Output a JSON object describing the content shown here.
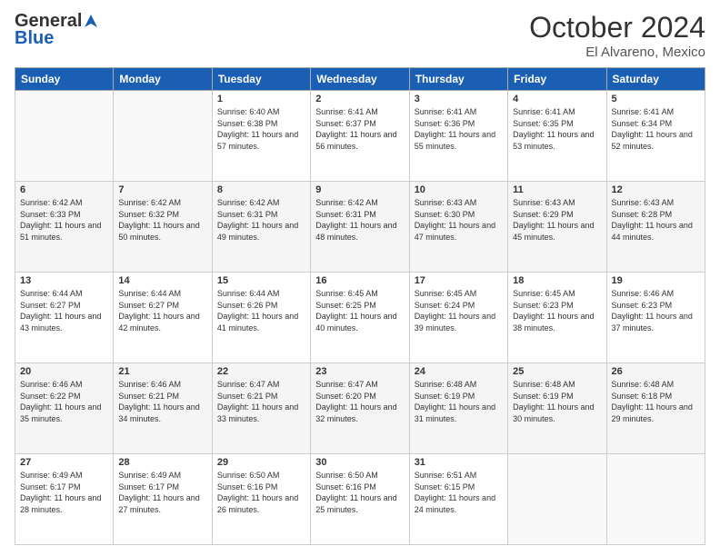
{
  "header": {
    "logo_general": "General",
    "logo_blue": "Blue",
    "month_title": "October 2024",
    "location": "El Alvareno, Mexico"
  },
  "weekdays": [
    "Sunday",
    "Monday",
    "Tuesday",
    "Wednesday",
    "Thursday",
    "Friday",
    "Saturday"
  ],
  "weeks": [
    [
      {
        "day": "",
        "sunrise": "",
        "sunset": "",
        "daylight": ""
      },
      {
        "day": "",
        "sunrise": "",
        "sunset": "",
        "daylight": ""
      },
      {
        "day": "1",
        "sunrise": "Sunrise: 6:40 AM",
        "sunset": "Sunset: 6:38 PM",
        "daylight": "Daylight: 11 hours and 57 minutes."
      },
      {
        "day": "2",
        "sunrise": "Sunrise: 6:41 AM",
        "sunset": "Sunset: 6:37 PM",
        "daylight": "Daylight: 11 hours and 56 minutes."
      },
      {
        "day": "3",
        "sunrise": "Sunrise: 6:41 AM",
        "sunset": "Sunset: 6:36 PM",
        "daylight": "Daylight: 11 hours and 55 minutes."
      },
      {
        "day": "4",
        "sunrise": "Sunrise: 6:41 AM",
        "sunset": "Sunset: 6:35 PM",
        "daylight": "Daylight: 11 hours and 53 minutes."
      },
      {
        "day": "5",
        "sunrise": "Sunrise: 6:41 AM",
        "sunset": "Sunset: 6:34 PM",
        "daylight": "Daylight: 11 hours and 52 minutes."
      }
    ],
    [
      {
        "day": "6",
        "sunrise": "Sunrise: 6:42 AM",
        "sunset": "Sunset: 6:33 PM",
        "daylight": "Daylight: 11 hours and 51 minutes."
      },
      {
        "day": "7",
        "sunrise": "Sunrise: 6:42 AM",
        "sunset": "Sunset: 6:32 PM",
        "daylight": "Daylight: 11 hours and 50 minutes."
      },
      {
        "day": "8",
        "sunrise": "Sunrise: 6:42 AM",
        "sunset": "Sunset: 6:31 PM",
        "daylight": "Daylight: 11 hours and 49 minutes."
      },
      {
        "day": "9",
        "sunrise": "Sunrise: 6:42 AM",
        "sunset": "Sunset: 6:31 PM",
        "daylight": "Daylight: 11 hours and 48 minutes."
      },
      {
        "day": "10",
        "sunrise": "Sunrise: 6:43 AM",
        "sunset": "Sunset: 6:30 PM",
        "daylight": "Daylight: 11 hours and 47 minutes."
      },
      {
        "day": "11",
        "sunrise": "Sunrise: 6:43 AM",
        "sunset": "Sunset: 6:29 PM",
        "daylight": "Daylight: 11 hours and 45 minutes."
      },
      {
        "day": "12",
        "sunrise": "Sunrise: 6:43 AM",
        "sunset": "Sunset: 6:28 PM",
        "daylight": "Daylight: 11 hours and 44 minutes."
      }
    ],
    [
      {
        "day": "13",
        "sunrise": "Sunrise: 6:44 AM",
        "sunset": "Sunset: 6:27 PM",
        "daylight": "Daylight: 11 hours and 43 minutes."
      },
      {
        "day": "14",
        "sunrise": "Sunrise: 6:44 AM",
        "sunset": "Sunset: 6:27 PM",
        "daylight": "Daylight: 11 hours and 42 minutes."
      },
      {
        "day": "15",
        "sunrise": "Sunrise: 6:44 AM",
        "sunset": "Sunset: 6:26 PM",
        "daylight": "Daylight: 11 hours and 41 minutes."
      },
      {
        "day": "16",
        "sunrise": "Sunrise: 6:45 AM",
        "sunset": "Sunset: 6:25 PM",
        "daylight": "Daylight: 11 hours and 40 minutes."
      },
      {
        "day": "17",
        "sunrise": "Sunrise: 6:45 AM",
        "sunset": "Sunset: 6:24 PM",
        "daylight": "Daylight: 11 hours and 39 minutes."
      },
      {
        "day": "18",
        "sunrise": "Sunrise: 6:45 AM",
        "sunset": "Sunset: 6:23 PM",
        "daylight": "Daylight: 11 hours and 38 minutes."
      },
      {
        "day": "19",
        "sunrise": "Sunrise: 6:46 AM",
        "sunset": "Sunset: 6:23 PM",
        "daylight": "Daylight: 11 hours and 37 minutes."
      }
    ],
    [
      {
        "day": "20",
        "sunrise": "Sunrise: 6:46 AM",
        "sunset": "Sunset: 6:22 PM",
        "daylight": "Daylight: 11 hours and 35 minutes."
      },
      {
        "day": "21",
        "sunrise": "Sunrise: 6:46 AM",
        "sunset": "Sunset: 6:21 PM",
        "daylight": "Daylight: 11 hours and 34 minutes."
      },
      {
        "day": "22",
        "sunrise": "Sunrise: 6:47 AM",
        "sunset": "Sunset: 6:21 PM",
        "daylight": "Daylight: 11 hours and 33 minutes."
      },
      {
        "day": "23",
        "sunrise": "Sunrise: 6:47 AM",
        "sunset": "Sunset: 6:20 PM",
        "daylight": "Daylight: 11 hours and 32 minutes."
      },
      {
        "day": "24",
        "sunrise": "Sunrise: 6:48 AM",
        "sunset": "Sunset: 6:19 PM",
        "daylight": "Daylight: 11 hours and 31 minutes."
      },
      {
        "day": "25",
        "sunrise": "Sunrise: 6:48 AM",
        "sunset": "Sunset: 6:19 PM",
        "daylight": "Daylight: 11 hours and 30 minutes."
      },
      {
        "day": "26",
        "sunrise": "Sunrise: 6:48 AM",
        "sunset": "Sunset: 6:18 PM",
        "daylight": "Daylight: 11 hours and 29 minutes."
      }
    ],
    [
      {
        "day": "27",
        "sunrise": "Sunrise: 6:49 AM",
        "sunset": "Sunset: 6:17 PM",
        "daylight": "Daylight: 11 hours and 28 minutes."
      },
      {
        "day": "28",
        "sunrise": "Sunrise: 6:49 AM",
        "sunset": "Sunset: 6:17 PM",
        "daylight": "Daylight: 11 hours and 27 minutes."
      },
      {
        "day": "29",
        "sunrise": "Sunrise: 6:50 AM",
        "sunset": "Sunset: 6:16 PM",
        "daylight": "Daylight: 11 hours and 26 minutes."
      },
      {
        "day": "30",
        "sunrise": "Sunrise: 6:50 AM",
        "sunset": "Sunset: 6:16 PM",
        "daylight": "Daylight: 11 hours and 25 minutes."
      },
      {
        "day": "31",
        "sunrise": "Sunrise: 6:51 AM",
        "sunset": "Sunset: 6:15 PM",
        "daylight": "Daylight: 11 hours and 24 minutes."
      },
      {
        "day": "",
        "sunrise": "",
        "sunset": "",
        "daylight": ""
      },
      {
        "day": "",
        "sunrise": "",
        "sunset": "",
        "daylight": ""
      }
    ]
  ]
}
